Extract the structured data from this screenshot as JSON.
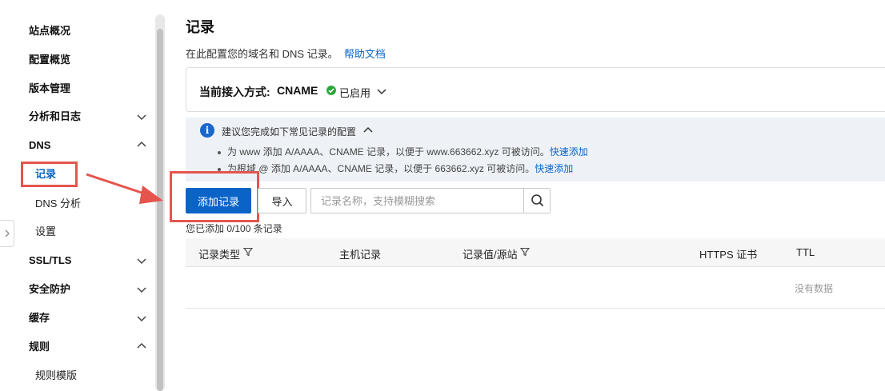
{
  "sidebar": {
    "items": [
      {
        "label": "站点概况"
      },
      {
        "label": "配置概览"
      },
      {
        "label": "版本管理"
      },
      {
        "label": "分析和日志",
        "chevron": "down"
      },
      {
        "label": "DNS",
        "chevron": "up"
      },
      {
        "label": "记录",
        "active": true
      },
      {
        "label": "DNS 分析"
      },
      {
        "label": "设置"
      },
      {
        "label": "SSL/TLS",
        "chevron": "down"
      },
      {
        "label": "安全防护",
        "chevron": "down"
      },
      {
        "label": "缓存",
        "chevron": "down"
      },
      {
        "label": "规则",
        "chevron": "up"
      },
      {
        "label": "规则模版"
      }
    ],
    "collapse_icon": "chevron-right-icon"
  },
  "main": {
    "title": "记录",
    "description": "在此配置您的域名和 DNS 记录。",
    "help_link": "帮助文档",
    "access": {
      "label": "当前接入方式:",
      "value": "CNAME",
      "status": "已启用",
      "status_color": "#2aa53a"
    },
    "tip": {
      "title": "建议您完成如下常见记录的配置",
      "lines": [
        {
          "text": "为 www 添加 A/AAAA、CNAME 记录，以便于 www.663662.xyz 可被访问。",
          "link": "快速添加"
        },
        {
          "text": "为根域 @ 添加 A/AAAA、CNAME 记录，以便于 663662.xyz 可被访问。",
          "link": "快速添加"
        }
      ]
    },
    "toolbar": {
      "add_label": "添加记录",
      "import_label": "导入",
      "search_placeholder": "记录名称，支持模糊搜索"
    },
    "count_text": "您已添加 0/100 条记录",
    "table": {
      "columns": [
        "记录类型",
        "主机记录",
        "记录值/源站",
        "HTTPS 证书",
        "TTL"
      ],
      "empty_text": "没有数据"
    }
  },
  "colors": {
    "accent": "#0a64c8",
    "highlight": "#e5554d"
  }
}
